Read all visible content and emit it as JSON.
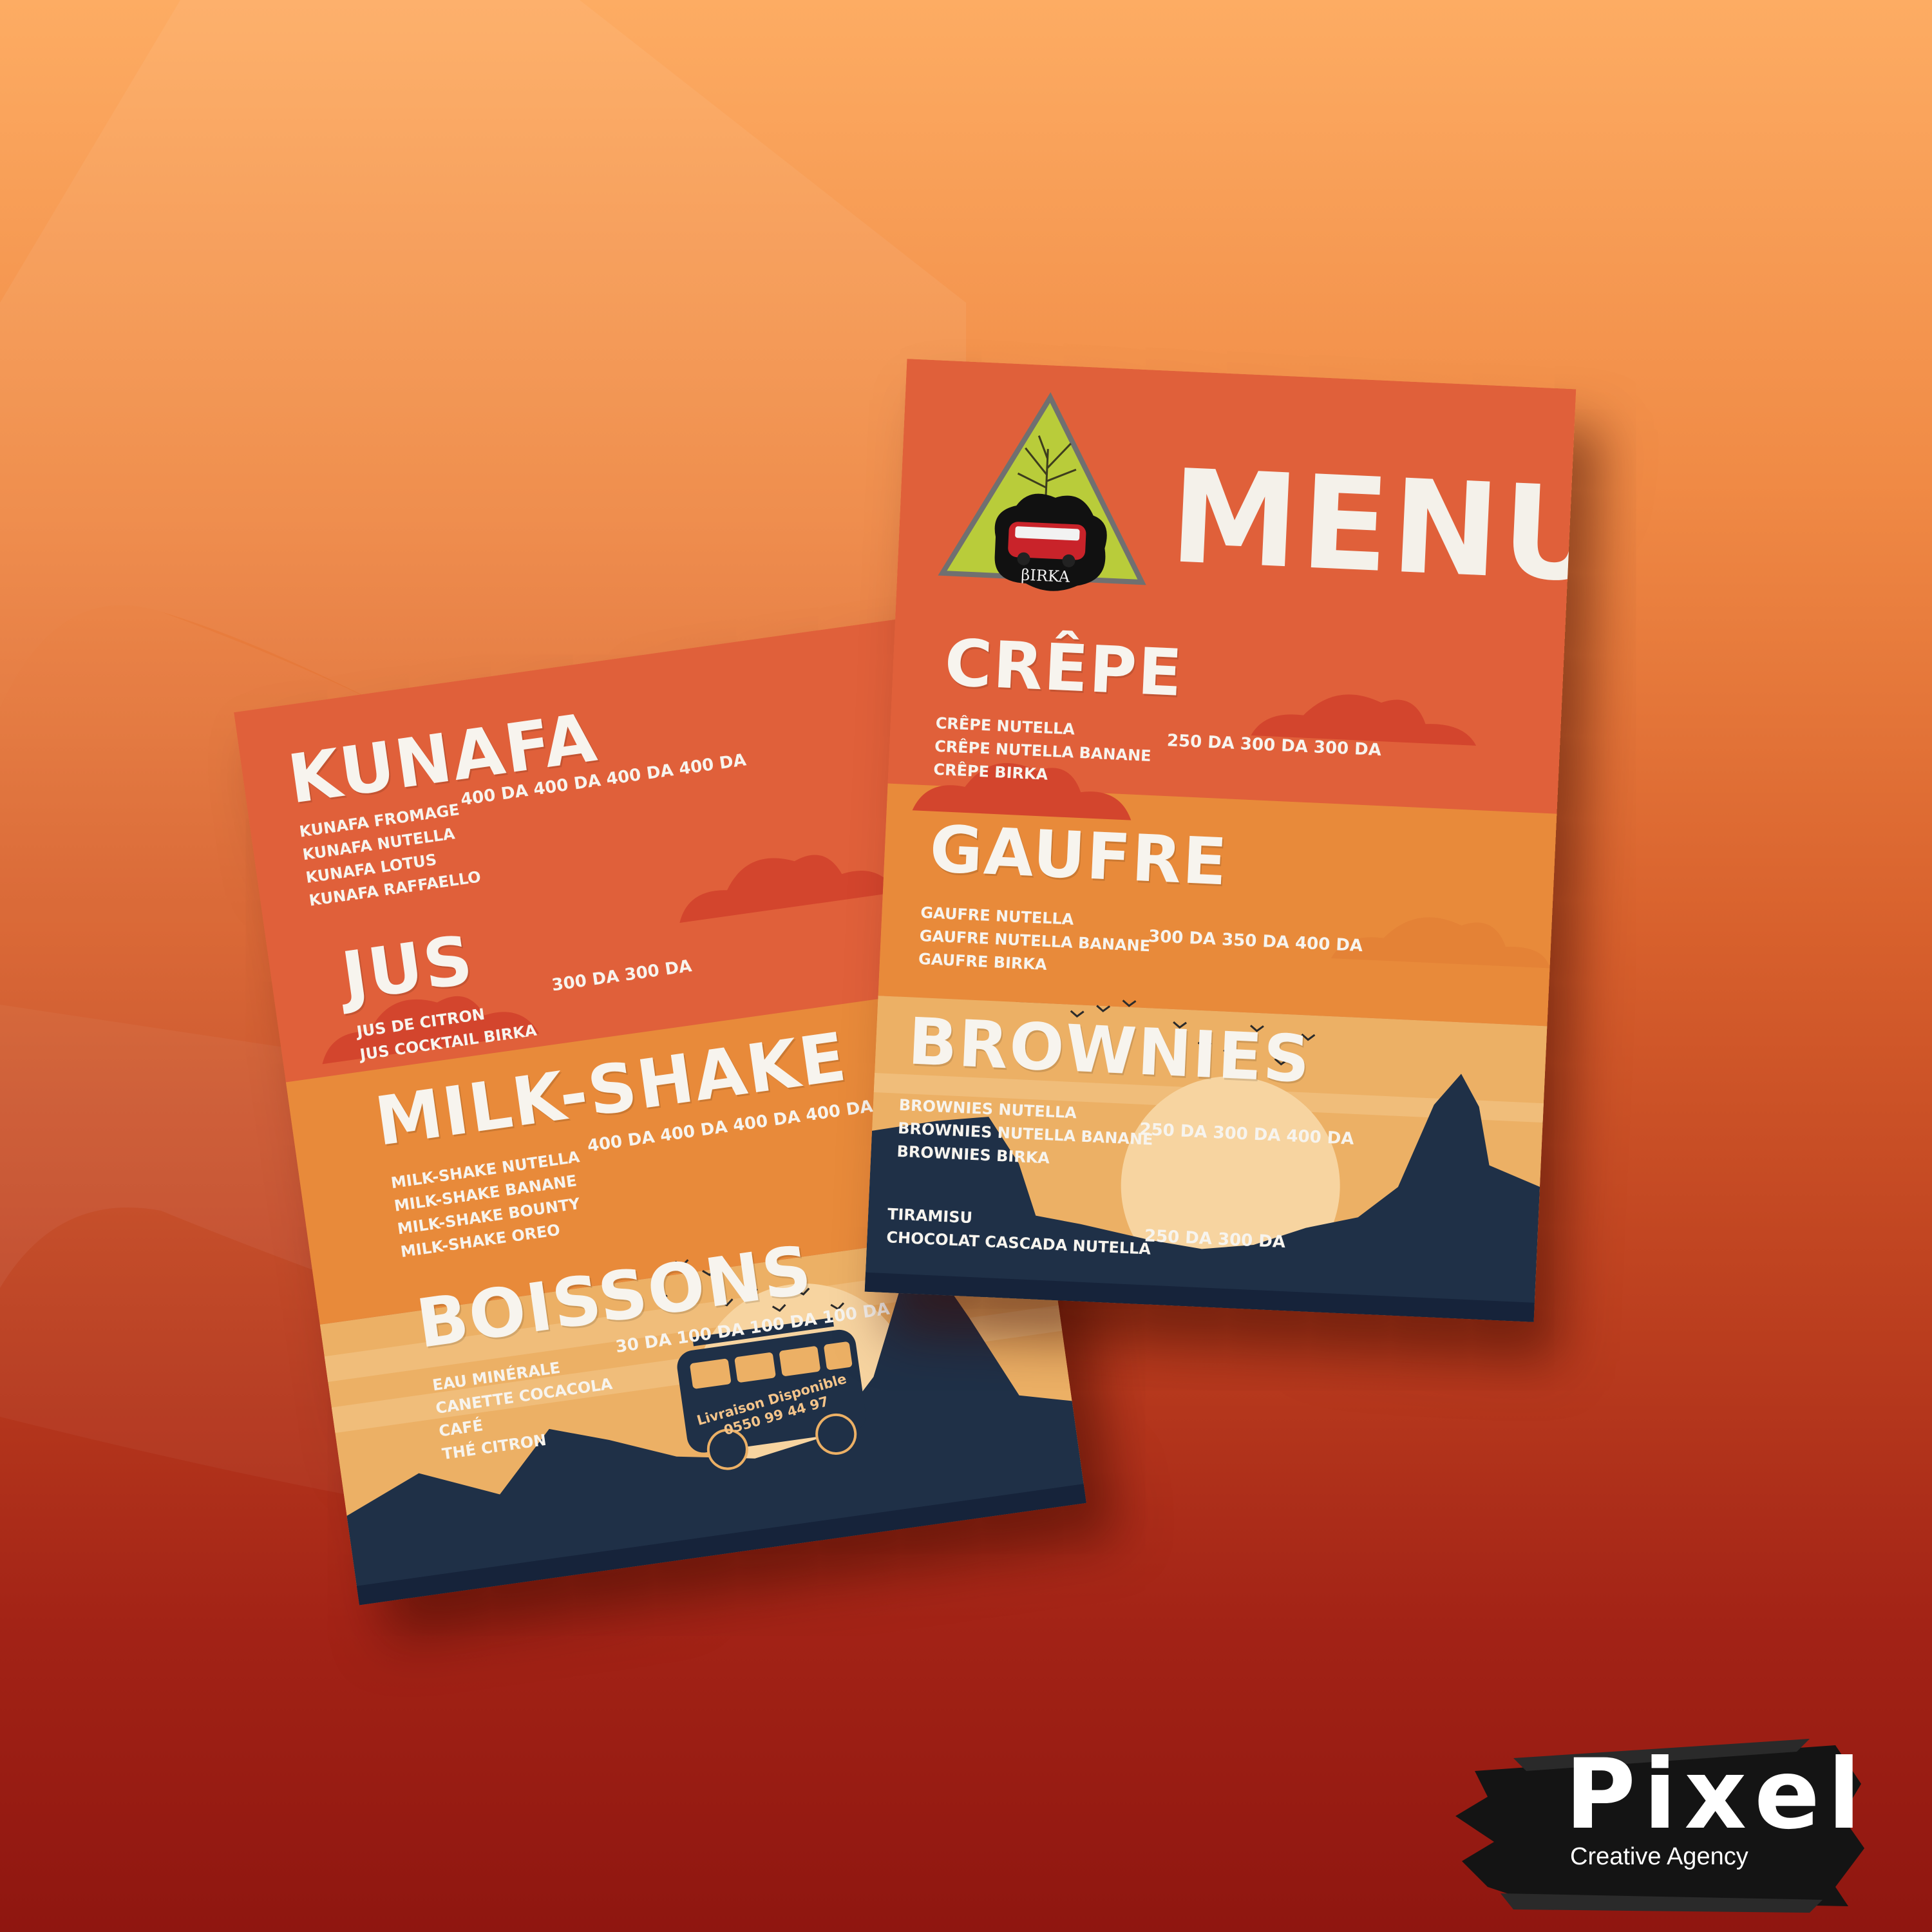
{
  "colors": {
    "band_top": "#e0603a",
    "band_mid": "#e88a3a",
    "band_low": "#ecb065",
    "silhouette": "#1f3047",
    "cloud": "#d3452d",
    "sun": "#f7d4a0",
    "logo_triangle": "#b9cc3a"
  },
  "back_menu": {
    "kunafa": {
      "title": "KUNAFA",
      "items": [
        "KUNAFA FROMAGE",
        "KUNAFA NUTELLA",
        "KUNAFA LOTUS",
        "KUNAFA RAFFAELLO"
      ],
      "prices": [
        "400 DA",
        "400 DA",
        "400 DA",
        "400 DA"
      ]
    },
    "jus": {
      "title": "JUS",
      "items": [
        "JUS DE CITRON",
        "JUS COCKTAIL BIRKA"
      ],
      "prices": [
        "300 DA",
        "300 DA"
      ]
    },
    "milkshake": {
      "title": "MILK-SHAKE",
      "items": [
        "MILK-SHAKE NUTELLA",
        "MILK-SHAKE BANANE",
        "MILK-SHAKE BOUNTY",
        "MILK-SHAKE OREO"
      ],
      "prices": [
        "400 DA",
        "400 DA",
        "400 DA",
        "400 DA"
      ]
    },
    "boissons": {
      "title": "BOISSONS",
      "items": [
        "EAU MINÉRALE",
        "CANETTE COCACOLA",
        "CAFÉ",
        "THÉ CITRON"
      ],
      "prices": [
        "30 DA",
        "100 DA",
        "100 DA",
        "100 DA"
      ]
    },
    "bus": {
      "line1": "Livraison Disponible",
      "line2": "0550 99 44 97"
    }
  },
  "front_menu": {
    "title": "MENU",
    "logo_text": "βIRKA",
    "crepe": {
      "title": "CRÊPE",
      "items": [
        "CRÊPE NUTELLA",
        "CRÊPE NUTELLA BANANE",
        "CRÊPE BIRKA"
      ],
      "prices": [
        "250 DA",
        "300 DA",
        "300 DA"
      ]
    },
    "gaufre": {
      "title": "GAUFRE",
      "items": [
        "GAUFRE NUTELLA",
        "GAUFRE NUTELLA BANANE",
        "GAUFRE BIRKA"
      ],
      "prices": [
        "300 DA",
        "350 DA",
        "400 DA"
      ]
    },
    "brownies": {
      "title": "BROWNIES",
      "items": [
        "BROWNIES NUTELLA",
        "BROWNIES NUTELLA BANANE",
        "BROWNIES BIRKA"
      ],
      "prices": [
        "250 DA",
        "300 DA",
        "400 DA"
      ]
    },
    "extras": {
      "items": [
        "TIRAMISU",
        "CHOCOLAT CASCADA NUTELLA"
      ],
      "prices": [
        "250 DA",
        "300 DA"
      ]
    }
  },
  "brand": {
    "name": "Pixel",
    "tagline": "Creative Agency"
  }
}
